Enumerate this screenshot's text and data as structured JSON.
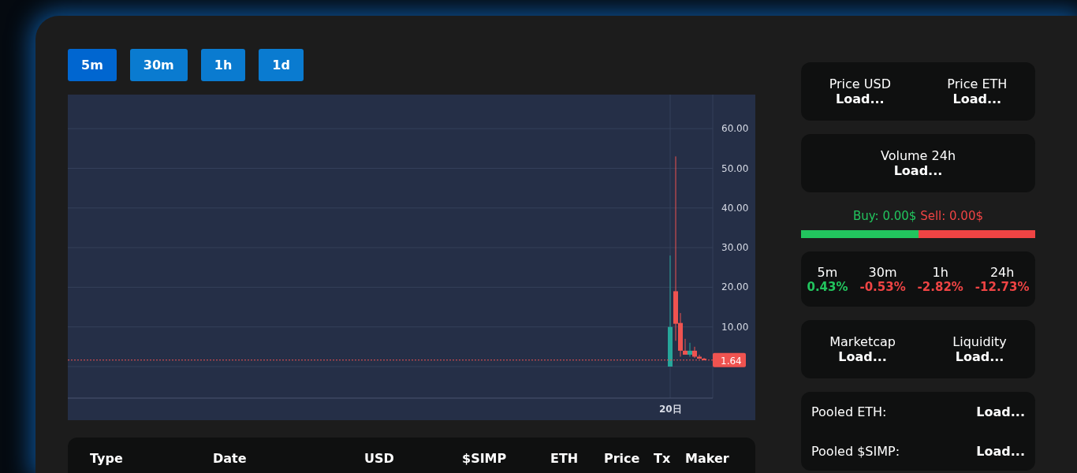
{
  "timeframes": [
    {
      "label": "5m",
      "selected": true
    },
    {
      "label": "30m",
      "selected": false
    },
    {
      "label": "1h",
      "selected": false
    },
    {
      "label": "1d",
      "selected": false
    }
  ],
  "chart": {
    "y_ticks": [
      "60.00",
      "50.00",
      "40.00",
      "30.00",
      "20.00",
      "10.00"
    ],
    "x_label": "20日",
    "last_price": "1.64"
  },
  "table": {
    "columns": [
      "Type",
      "Date",
      "USD",
      "$SIMP",
      "ETH",
      "Price",
      "Tx",
      "Maker"
    ]
  },
  "price_card": [
    {
      "label": "Price USD",
      "value": "Load..."
    },
    {
      "label": "Price ETH",
      "value": "Load..."
    }
  ],
  "volume_card": [
    {
      "label": "Volume 24h",
      "value": "Load..."
    }
  ],
  "buy_sell": {
    "buy": "Buy: 0.00$",
    "sell": "Sell: 0.00$",
    "level": 0.5
  },
  "changes": [
    {
      "period": "5m",
      "value": "0.43%",
      "positive": true
    },
    {
      "period": "30m",
      "value": "-0.53%",
      "positive": false
    },
    {
      "period": "1h",
      "value": "-2.82%",
      "positive": false
    },
    {
      "period": "24h",
      "value": "-12.73%",
      "positive": false
    }
  ],
  "market_card": [
    {
      "label": "Marketcap",
      "value": "Load..."
    },
    {
      "label": "Liquidity",
      "value": "Load..."
    }
  ],
  "pooled": [
    {
      "label": "Pooled ETH:",
      "value": "Load..."
    },
    {
      "label": "Pooled $SIMP:",
      "value": "Load..."
    }
  ]
}
